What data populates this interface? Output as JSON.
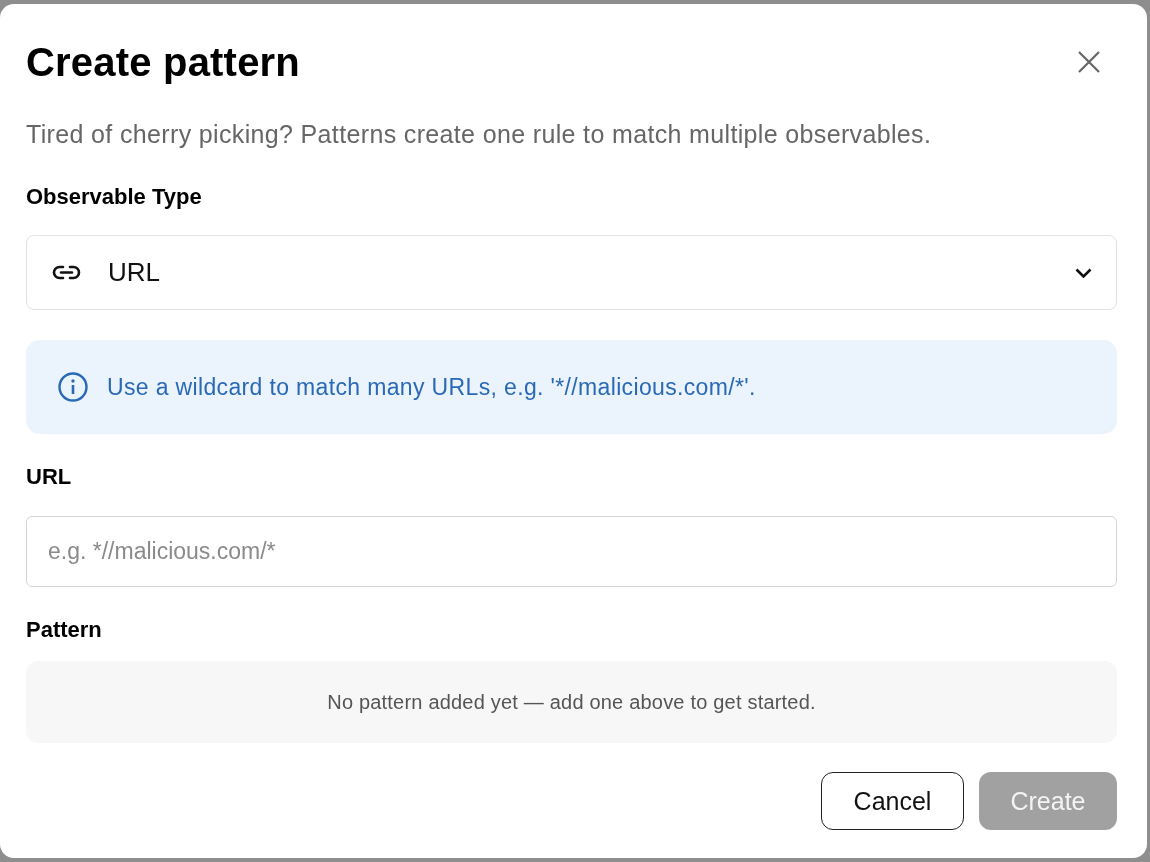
{
  "dialog": {
    "title": "Create pattern",
    "subtitle": "Tired of cherry picking? Patterns create one rule to match multiple observables."
  },
  "observable_type": {
    "label": "Observable Type",
    "value": "URL"
  },
  "info": {
    "text": "Use a wildcard to match many URLs, e.g. '*//malicious.com/*'."
  },
  "url_field": {
    "label": "URL",
    "placeholder": "e.g. *//malicious.com/*"
  },
  "pattern": {
    "label": "Pattern",
    "empty_text": "No pattern added yet — add one above to get started."
  },
  "buttons": [
    {
      "label": "Cancel",
      "kind": "secondary",
      "disabled": false
    },
    {
      "label": "Create",
      "kind": "primary",
      "disabled": true
    }
  ]
}
